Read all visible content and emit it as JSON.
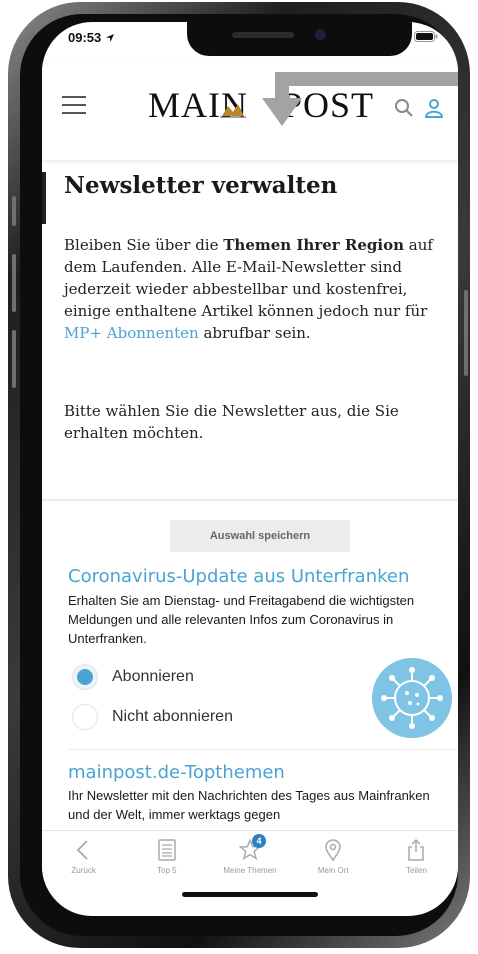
{
  "status_bar": {
    "time": "09:53"
  },
  "header": {
    "logo_left": "MAIN",
    "logo_right": "POST"
  },
  "page": {
    "title": "Newsletter verwalten",
    "intro_1": "Bleiben Sie über die ",
    "intro_bold": "Themen Ihrer Region",
    "intro_2": " auf dem Laufenden. Alle E-Mail-Newsletter sind jederzeit wieder abbestellbar und kostenfrei, einige enthaltene Artikel können jedoch nur für ",
    "intro_link": "MP+ Abonnenten",
    "intro_3": " abrufbar sein.",
    "instruction": "Bitte wählen Sie die Newsletter aus, die Sie erhalten möchten."
  },
  "save_button": "Auswahl speichern",
  "newsletters": [
    {
      "title": "Coronavirus-Update aus Unterfranken",
      "description": "Erhalten Sie am Dienstag- und Freitagabend die wichtigsten Meldungen und alle relevanten Infos zum Coronavirus in Unterfranken.",
      "options": [
        "Abonnieren",
        "Nicht abonnieren"
      ],
      "selected": "Abonnieren",
      "icon": "coronavirus-icon"
    },
    {
      "title": "mainpost.de-Topthemen",
      "description": "Ihr Newsletter mit den Nachrichten des Tages aus Mainfranken und der Welt, immer werktags gegen"
    }
  ],
  "tabs": [
    {
      "label": "Zurück",
      "icon": "back-chevron-icon"
    },
    {
      "label": "Top 5",
      "icon": "list-icon"
    },
    {
      "label": "Meine Themen",
      "icon": "star-icon",
      "badge": "4"
    },
    {
      "label": "Mein Ort",
      "icon": "location-pin-icon"
    },
    {
      "label": "Teilen",
      "icon": "share-icon"
    }
  ],
  "colors": {
    "accent": "#4aa3d4",
    "badge": "#2c7fc1",
    "text": "#1a1a1a"
  }
}
